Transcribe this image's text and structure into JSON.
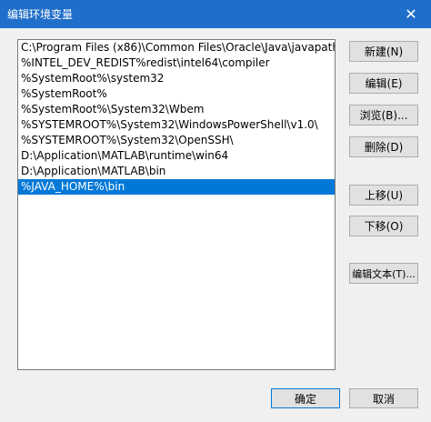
{
  "window": {
    "title": "编辑环境变量",
    "close_glyph": "✕"
  },
  "path_list": {
    "items": [
      "C:\\Program Files (x86)\\Common Files\\Oracle\\Java\\javapath",
      "%INTEL_DEV_REDIST%redist\\intel64\\compiler",
      "%SystemRoot%\\system32",
      "%SystemRoot%",
      "%SystemRoot%\\System32\\Wbem",
      "%SYSTEMROOT%\\System32\\WindowsPowerShell\\v1.0\\",
      "%SYSTEMROOT%\\System32\\OpenSSH\\",
      "D:\\Application\\MATLAB\\runtime\\win64",
      "D:\\Application\\MATLAB\\bin",
      "%JAVA_HOME%\\bin"
    ],
    "selected_index": 9
  },
  "buttons": {
    "new": "新建(N)",
    "edit": "编辑(E)",
    "browse": "浏览(B)...",
    "delete": "删除(D)",
    "move_up": "上移(U)",
    "move_down": "下移(O)",
    "edit_text": "编辑文本(T)...",
    "ok": "确定",
    "cancel": "取消"
  },
  "colors": {
    "titlebar": "#1f6ec9",
    "selection": "#0078d7"
  }
}
